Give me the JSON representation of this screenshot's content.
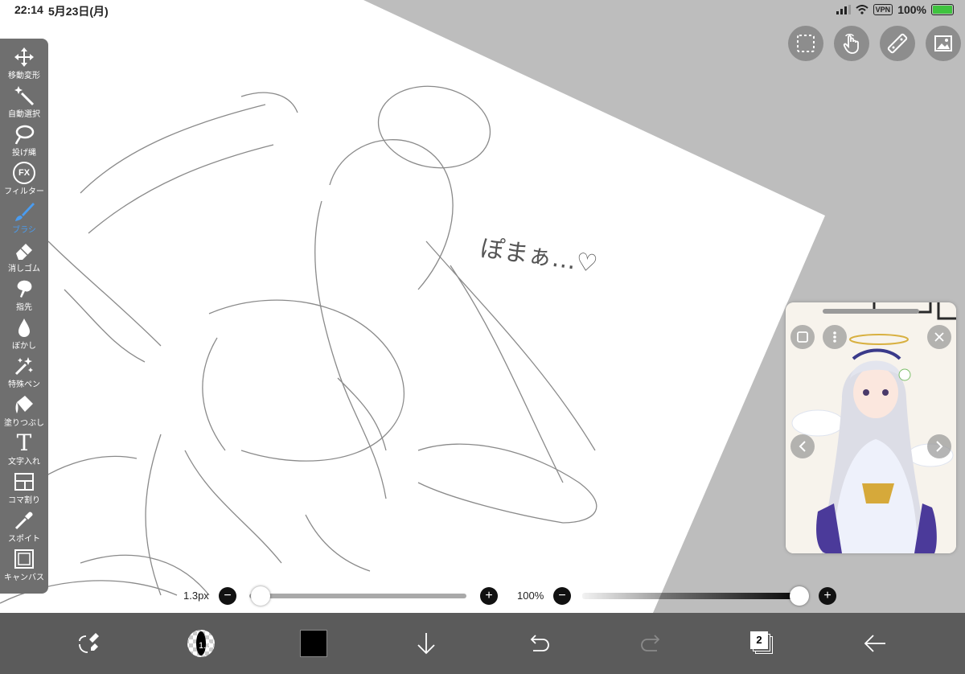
{
  "status": {
    "time": "22:14",
    "date": "5月23日(月)",
    "vpn": "VPN",
    "battery": "100%"
  },
  "tools": [
    {
      "label": "移動変形",
      "icon": "move-icon"
    },
    {
      "label": "自動選択",
      "icon": "magic-wand-icon"
    },
    {
      "label": "投げ縄",
      "icon": "lasso-icon"
    },
    {
      "label": "フィルター",
      "icon": "fx-icon",
      "glyph": "FX"
    },
    {
      "label": "ブラシ",
      "icon": "brush-icon",
      "active": true
    },
    {
      "label": "消しゴム",
      "icon": "eraser-icon"
    },
    {
      "label": "指先",
      "icon": "smudge-icon"
    },
    {
      "label": "ぼかし",
      "icon": "blur-drop-icon"
    },
    {
      "label": "特殊ペン",
      "icon": "special-pen-icon"
    },
    {
      "label": "塗りつぶし",
      "icon": "fill-bucket-icon"
    },
    {
      "label": "文字入れ",
      "icon": "text-icon",
      "glyph": "T"
    },
    {
      "label": "コマ割り",
      "icon": "frame-divide-icon"
    },
    {
      "label": "スポイト",
      "icon": "eyedropper-icon"
    },
    {
      "label": "キャンバス",
      "icon": "canvas-icon"
    }
  ],
  "canvas": {
    "handwriting": "ぽまぁ…♡"
  },
  "brush": {
    "size_label": "1.3px",
    "size_value": 1.3,
    "opacity_label": "100%",
    "opacity_value": 100,
    "size_badge": "1.3"
  },
  "layers": {
    "count": "2"
  },
  "colors": {
    "accent": "#4a9cf0",
    "toolbar": "#6f6f6f",
    "bottom_bar": "#5b5b5b",
    "current_color": "#000000"
  }
}
